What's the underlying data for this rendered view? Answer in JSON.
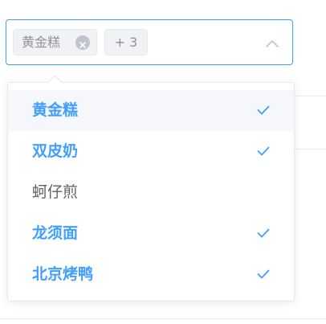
{
  "select": {
    "tags": [
      {
        "label": "黄金糕"
      }
    ],
    "collapsed_count_label": "+ 3",
    "arrow_icon": "chevron-up-icon"
  },
  "dropdown": {
    "options": [
      {
        "label": "黄金糕",
        "selected": true,
        "hovered": true
      },
      {
        "label": "双皮奶",
        "selected": true,
        "hovered": false
      },
      {
        "label": "蚵仔煎",
        "selected": false,
        "hovered": false
      },
      {
        "label": "龙须面",
        "selected": true,
        "hovered": false
      },
      {
        "label": "北京烤鸭",
        "selected": true,
        "hovered": false
      }
    ],
    "check_icon": "check-icon"
  },
  "colors": {
    "accent": "#409eff",
    "text": "#606266",
    "tag_text": "#909399",
    "tag_bg": "#f0f2f5",
    "hover_bg": "#f5f7fa",
    "border": "#e4e7ed"
  }
}
